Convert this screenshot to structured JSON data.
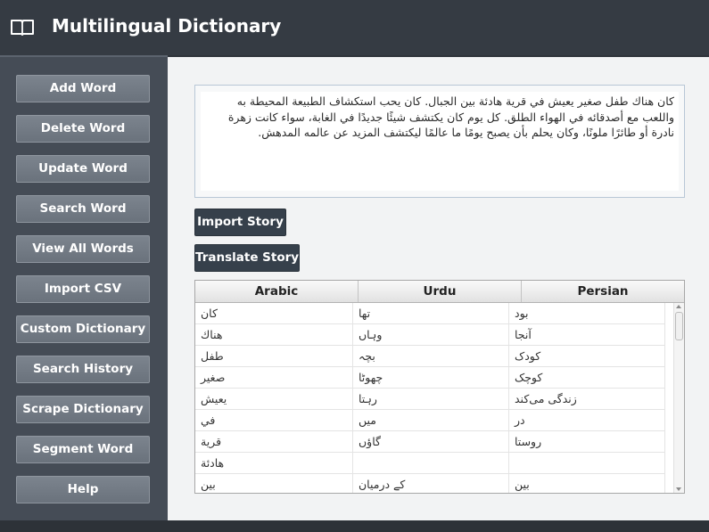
{
  "app": {
    "title": "Multilingual Dictionary",
    "icon": "book-icon"
  },
  "sidebar": {
    "buttons": [
      "Add Word",
      "Delete Word",
      "Update Word",
      "Search Word",
      "View All Words",
      "Import CSV",
      "Custom Dictionary",
      "Search History",
      "Scrape Dictionary",
      "Segment Word",
      "Help"
    ]
  },
  "story": {
    "text": "كان هناك طفل صغير يعيش في قرية هادئة بين الجبال. كان يحب استكشاف الطبيعة المحيطة به واللعب مع أصدقائه في الهواء الطلق. كل يوم كان يكتشف شيئًا جديدًا في الغابة، سواء كانت زهرة نادرة أو طائرًا ملونًا، وكان يحلم بأن يصبح يومًا ما عالمًا ليكتشف المزيد عن عالمه المدهش."
  },
  "actions": {
    "import_story": "Import Story",
    "translate_story": "Translate Story"
  },
  "table": {
    "headers": [
      "Arabic",
      "Urdu",
      "Persian"
    ],
    "rows": [
      [
        "كان",
        "تھا",
        "بود"
      ],
      [
        "هناك",
        "وہاں",
        "آنجا"
      ],
      [
        "طفل",
        "بچہ",
        "کودک"
      ],
      [
        "صغير",
        "چھوٹا",
        "کوچک"
      ],
      [
        "يعيش",
        "رہتا",
        "زندگی می‌کند"
      ],
      [
        "في",
        "میں",
        "در"
      ],
      [
        "قرية",
        "گاؤں",
        "روستا"
      ],
      [
        "هادئة",
        "",
        ""
      ],
      [
        "بين",
        "کے درمیان",
        "بین"
      ]
    ]
  },
  "colors": {
    "titlebar": "#353b43",
    "sidebar": "#454c56",
    "button": "#6a727c",
    "dark_button": "#36404b",
    "main_bg": "#f2f3f4"
  }
}
